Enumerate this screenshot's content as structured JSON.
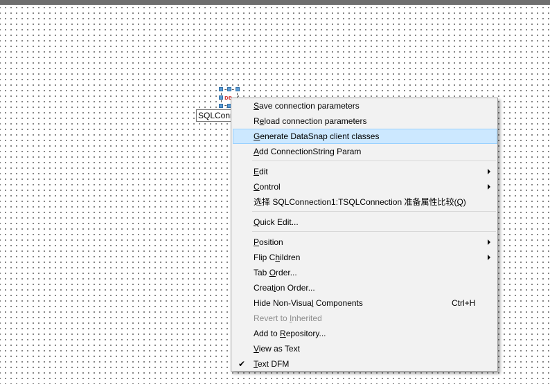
{
  "component": {
    "caption": "SQLConnection1",
    "glyph": "DB"
  },
  "menu": {
    "items": [
      {
        "pre": "",
        "acc": "S",
        "post": "ave connection parameters"
      },
      {
        "pre": "R",
        "acc": "e",
        "post": "load connection parameters"
      },
      {
        "pre": "",
        "acc": "G",
        "post": "enerate DataSnap client classes"
      },
      {
        "pre": "",
        "acc": "A",
        "post": "dd ConnectionString Param"
      },
      {
        "pre": "",
        "acc": "E",
        "post": "dit"
      },
      {
        "pre": "",
        "acc": "C",
        "post": "ontrol"
      },
      {
        "pre": "选择 SQLConnection1:TSQLConnection 准备属性比较(",
        "acc": "Q",
        "post": ")"
      },
      {
        "pre": "",
        "acc": "Q",
        "post": "uick Edit..."
      },
      {
        "pre": "",
        "acc": "P",
        "post": "osition"
      },
      {
        "pre": "Flip C",
        "acc": "h",
        "post": "ildren"
      },
      {
        "pre": "Tab ",
        "acc": "O",
        "post": "rder..."
      },
      {
        "pre": "Creat",
        "acc": "i",
        "post": "on Order..."
      },
      {
        "pre": "Hide Non-Visua",
        "acc": "l",
        "post": " Components",
        "shortcut": "Ctrl+H"
      },
      {
        "pre": "Revert to ",
        "acc": "I",
        "post": "nherited"
      },
      {
        "pre": "Add to ",
        "acc": "R",
        "post": "epository..."
      },
      {
        "pre": "",
        "acc": "V",
        "post": "iew as Text"
      },
      {
        "pre": "",
        "acc": "T",
        "post": "ext DFM",
        "check": "✔"
      }
    ]
  }
}
